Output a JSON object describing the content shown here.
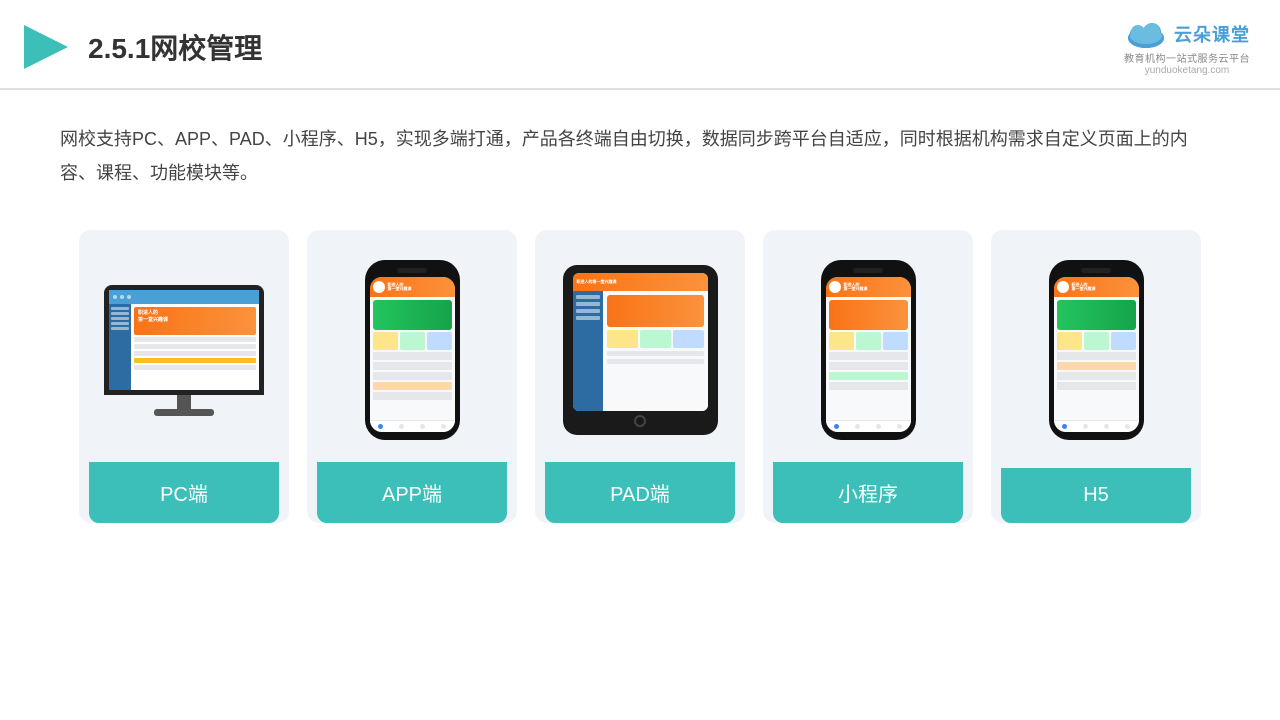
{
  "header": {
    "title": "2.5.1网校管理",
    "logo_text": "云朵课堂",
    "logo_sub": "教育机构一站\n式服务云平台",
    "logo_url": "yunduoketang.com"
  },
  "description": {
    "text": "网校支持PC、APP、PAD、小程序、H5，实现多端打通，产品各终端自由切换，数据同步跨平台自适应，同时根据机构需求自定义页面上的内容、课程、功能模块等。"
  },
  "cards": [
    {
      "id": "pc",
      "label": "PC端"
    },
    {
      "id": "app",
      "label": "APP端"
    },
    {
      "id": "pad",
      "label": "PAD端"
    },
    {
      "id": "miniapp",
      "label": "小程序"
    },
    {
      "id": "h5",
      "label": "H5"
    }
  ],
  "colors": {
    "teal": "#3bbfb8",
    "accent": "#4a9fd4"
  }
}
